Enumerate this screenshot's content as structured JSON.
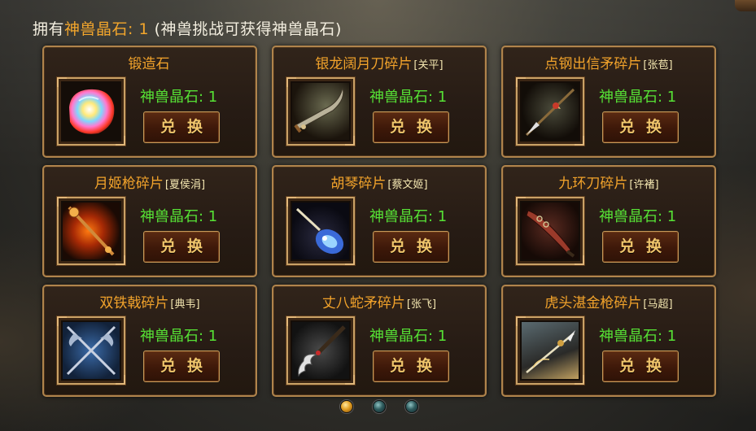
{
  "header": {
    "prefix": "拥有",
    "currency_name": "神兽晶石",
    "colon": ": ",
    "count": "1",
    "hint": " (神兽挑战可获得神兽晶石)"
  },
  "items": [
    {
      "name": "锻造石",
      "hero": "",
      "cost": "神兽晶石: 1",
      "button": "兑换",
      "icon": "forging-stone-icon"
    },
    {
      "name": "银龙阔月刀碎片",
      "hero": "[关平]",
      "cost": "神兽晶石: 1",
      "button": "兑换",
      "icon": "crescent-blade-icon"
    },
    {
      "name": "点钢出信矛碎片",
      "hero": "[张苞]",
      "cost": "神兽晶石: 1",
      "button": "兑换",
      "icon": "spear-icon"
    },
    {
      "name": "月姬枪碎片",
      "hero": "[夏侯涓]",
      "cost": "神兽晶石: 1",
      "button": "兑换",
      "icon": "moon-lance-icon"
    },
    {
      "name": "胡琴碎片",
      "hero": "[蔡文姬]",
      "cost": "神兽晶石: 1",
      "button": "兑换",
      "icon": "pipa-icon"
    },
    {
      "name": "九环刀碎片",
      "hero": "[许褚]",
      "cost": "神兽晶石: 1",
      "button": "兑换",
      "icon": "ring-blade-icon"
    },
    {
      "name": "双铁戟碎片",
      "hero": "[典韦]",
      "cost": "神兽晶石: 1",
      "button": "兑换",
      "icon": "twin-halberds-icon"
    },
    {
      "name": "丈八蛇矛碎片",
      "hero": "[张飞]",
      "cost": "神兽晶石: 1",
      "button": "兑换",
      "icon": "serpent-spear-icon"
    },
    {
      "name": "虎头湛金枪碎片",
      "hero": "[马超]",
      "cost": "神兽晶石: 1",
      "button": "兑换",
      "icon": "tiger-spear-icon"
    }
  ],
  "pagination": {
    "pages": 3,
    "current": 1
  },
  "colors": {
    "title": "#f2a32b",
    "cost": "#56e135",
    "border": "#b0844c",
    "button_text": "#f0c56b"
  }
}
